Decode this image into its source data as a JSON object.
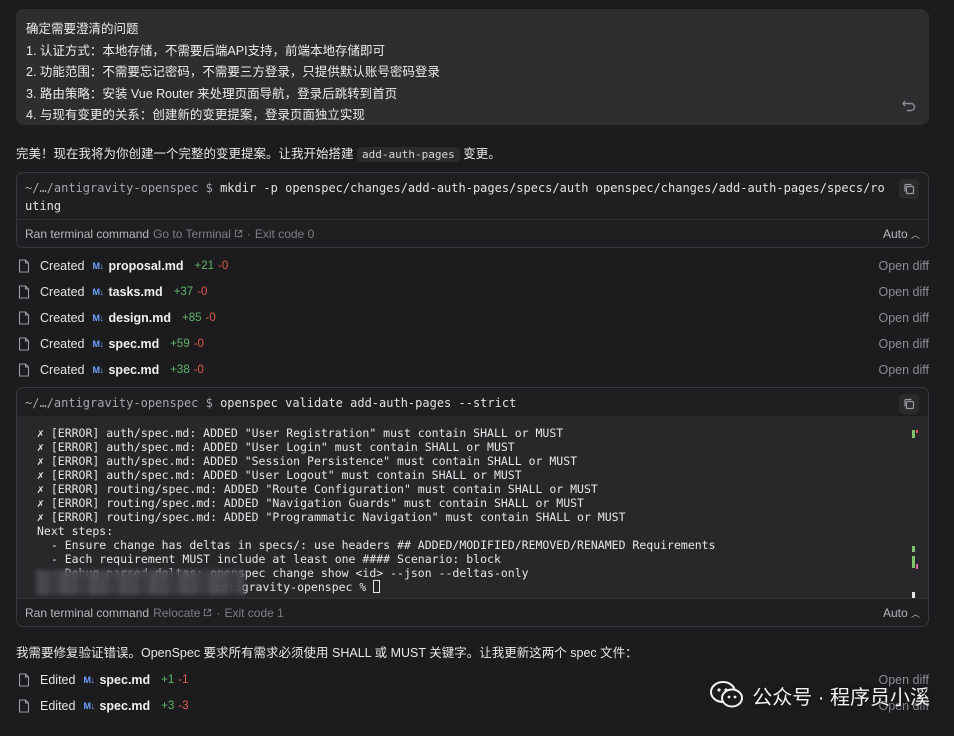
{
  "user_message": {
    "lines": [
      "确定需要澄清的问题",
      "1. 认证方式：本地存储，不需要后端API支持，前端本地存储即可",
      "2. 功能范围：不需要忘记密码，不需要三方登录，只提供默认账号密码登录",
      "3. 路由策略：安装 Vue Router 来处理页面导航，登录后跳转到首页",
      "4. 与现有变更的关系：创建新的变更提案，登录页面独立实现"
    ]
  },
  "assistant": {
    "intro_before": "完美！现在我将为你创建一个完整的变更提案。让我开始搭建",
    "intro_code": "add-auth-pages",
    "intro_after": "变更。",
    "fix_text": "我需要修复验证错误。OpenSpec 要求所有需求必须使用 SHALL 或 MUST 关键字。让我更新这两个 spec 文件："
  },
  "terminal1": {
    "prompt": "~/…/antigravity-openspec $",
    "command": "mkdir -p openspec/changes/add-auth-pages/specs/auth openspec/changes/add-auth-pages/specs/routing",
    "status": "Ran terminal command",
    "link": "Go to Terminal",
    "exit": "Exit code 0",
    "mode": "Auto"
  },
  "created_files": [
    {
      "verb": "Created",
      "badge": "M↓",
      "name": "proposal.md",
      "plus": "+21",
      "minus": "-0",
      "action": "Open diff"
    },
    {
      "verb": "Created",
      "badge": "M↓",
      "name": "tasks.md",
      "plus": "+37",
      "minus": "-0",
      "action": "Open diff"
    },
    {
      "verb": "Created",
      "badge": "M↓",
      "name": "design.md",
      "plus": "+85",
      "minus": "-0",
      "action": "Open diff"
    },
    {
      "verb": "Created",
      "badge": "M↓",
      "name": "spec.md",
      "plus": "+59",
      "minus": "-0",
      "action": "Open diff"
    },
    {
      "verb": "Created",
      "badge": "M↓",
      "name": "spec.md",
      "plus": "+38",
      "minus": "-0",
      "action": "Open diff"
    }
  ],
  "terminal2": {
    "prompt": "~/…/antigravity-openspec $",
    "command": "openspec validate add-auth-pages --strict",
    "output": [
      "✗ [ERROR] auth/spec.md: ADDED \"User Registration\" must contain SHALL or MUST",
      "✗ [ERROR] auth/spec.md: ADDED \"User Login\" must contain SHALL or MUST",
      "✗ [ERROR] auth/spec.md: ADDED \"Session Persistence\" must contain SHALL or MUST",
      "✗ [ERROR] auth/spec.md: ADDED \"User Logout\" must contain SHALL or MUST",
      "✗ [ERROR] routing/spec.md: ADDED \"Route Configuration\" must contain SHALL or MUST",
      "✗ [ERROR] routing/spec.md: ADDED \"Navigation Guards\" must contain SHALL or MUST",
      "✗ [ERROR] routing/spec.md: ADDED \"Programmatic Navigation\" must contain SHALL or MUST",
      "Next steps:",
      "  - Ensure change has deltas in specs/: use headers ## ADDED/MODIFIED/REMOVED/RENAMED Requirements",
      "  - Each requirement MUST include at least one #### Scenario: block",
      "  - Debug parsed deltas: openspec change show <id> --json --deltas-only"
    ],
    "shell_prompt": "antigravity-openspec % ",
    "status": "Ran terminal command",
    "link": "Relocate",
    "exit": "Exit code 1",
    "mode": "Auto"
  },
  "edited_files": [
    {
      "verb": "Edited",
      "badge": "M↓",
      "name": "spec.md",
      "plus": "+1",
      "minus": "-1",
      "action": "Open diff"
    },
    {
      "verb": "Edited",
      "badge": "M↓",
      "name": "spec.md",
      "plus": "+3",
      "minus": "-3",
      "action": "Open diff"
    }
  ],
  "watermark": {
    "text": "公众号 · 程序员小溪"
  }
}
